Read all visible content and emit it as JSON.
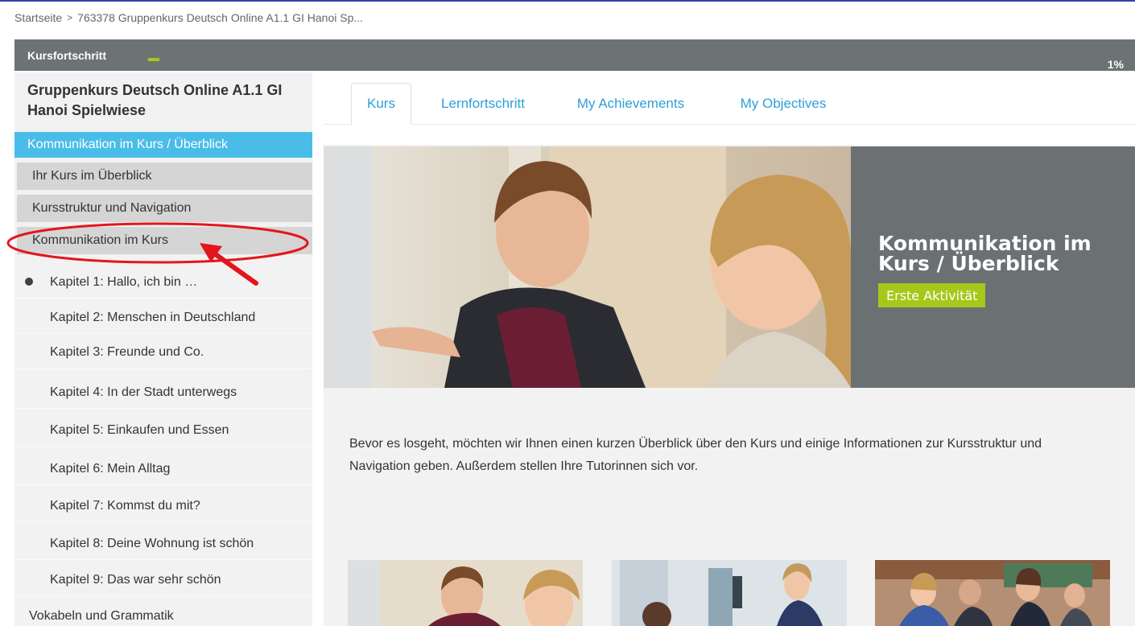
{
  "breadcrumb": {
    "home": "Startseite",
    "separator": ">",
    "current": "763378 Gruppenkurs Deutsch Online A1.1 GI Hanoi Sp..."
  },
  "progress": {
    "label": "Kursfortschritt",
    "value_percent": 1,
    "text": "1%"
  },
  "sidebar": {
    "course_title": "Gruppenkurs Deutsch Online A1.1 GI Hanoi Spielwiese",
    "active_section": "Kommunikation im Kurs / Überblick",
    "sub_items": [
      "Ihr Kurs im Überblick",
      "Kursstruktur und Navigation",
      "Kommunikation im Kurs"
    ],
    "chapters": [
      "Kapitel 1: Hallo, ich bin …",
      "Kapitel 2: Menschen in Deutschland",
      "Kapitel 3: Freunde und Co.",
      "Kapitel 4: In der Stadt unterwegs",
      "Kapitel 5: Einkaufen und Essen",
      "Kapitel 6: Mein Alltag",
      "Kapitel 7: Kommst du mit?",
      "Kapitel 8: Deine Wohnung ist schön",
      "Kapitel 9: Das war sehr schön"
    ],
    "vocab": "Vokabeln und Grammatik"
  },
  "tabs": [
    "Kurs",
    "Lernfortschritt",
    "My Achievements",
    "My Objectives"
  ],
  "hero": {
    "title": "Kommunikation im Kurs / Überblick",
    "button": "Erste Aktivität"
  },
  "intro_text": "Bevor es losgeht, möchten wir Ihnen einen kurzen Überblick über den Kurs und einige Informationen zur Kursstruktur und Navigation geben. Außerdem stellen Ihre Tutorinnen sich vor.",
  "colors": {
    "accent_blue": "#49bde8",
    "accent_green": "#a6c81a",
    "panel_gray": "#6b7173",
    "annotation_red": "#e3161b"
  }
}
